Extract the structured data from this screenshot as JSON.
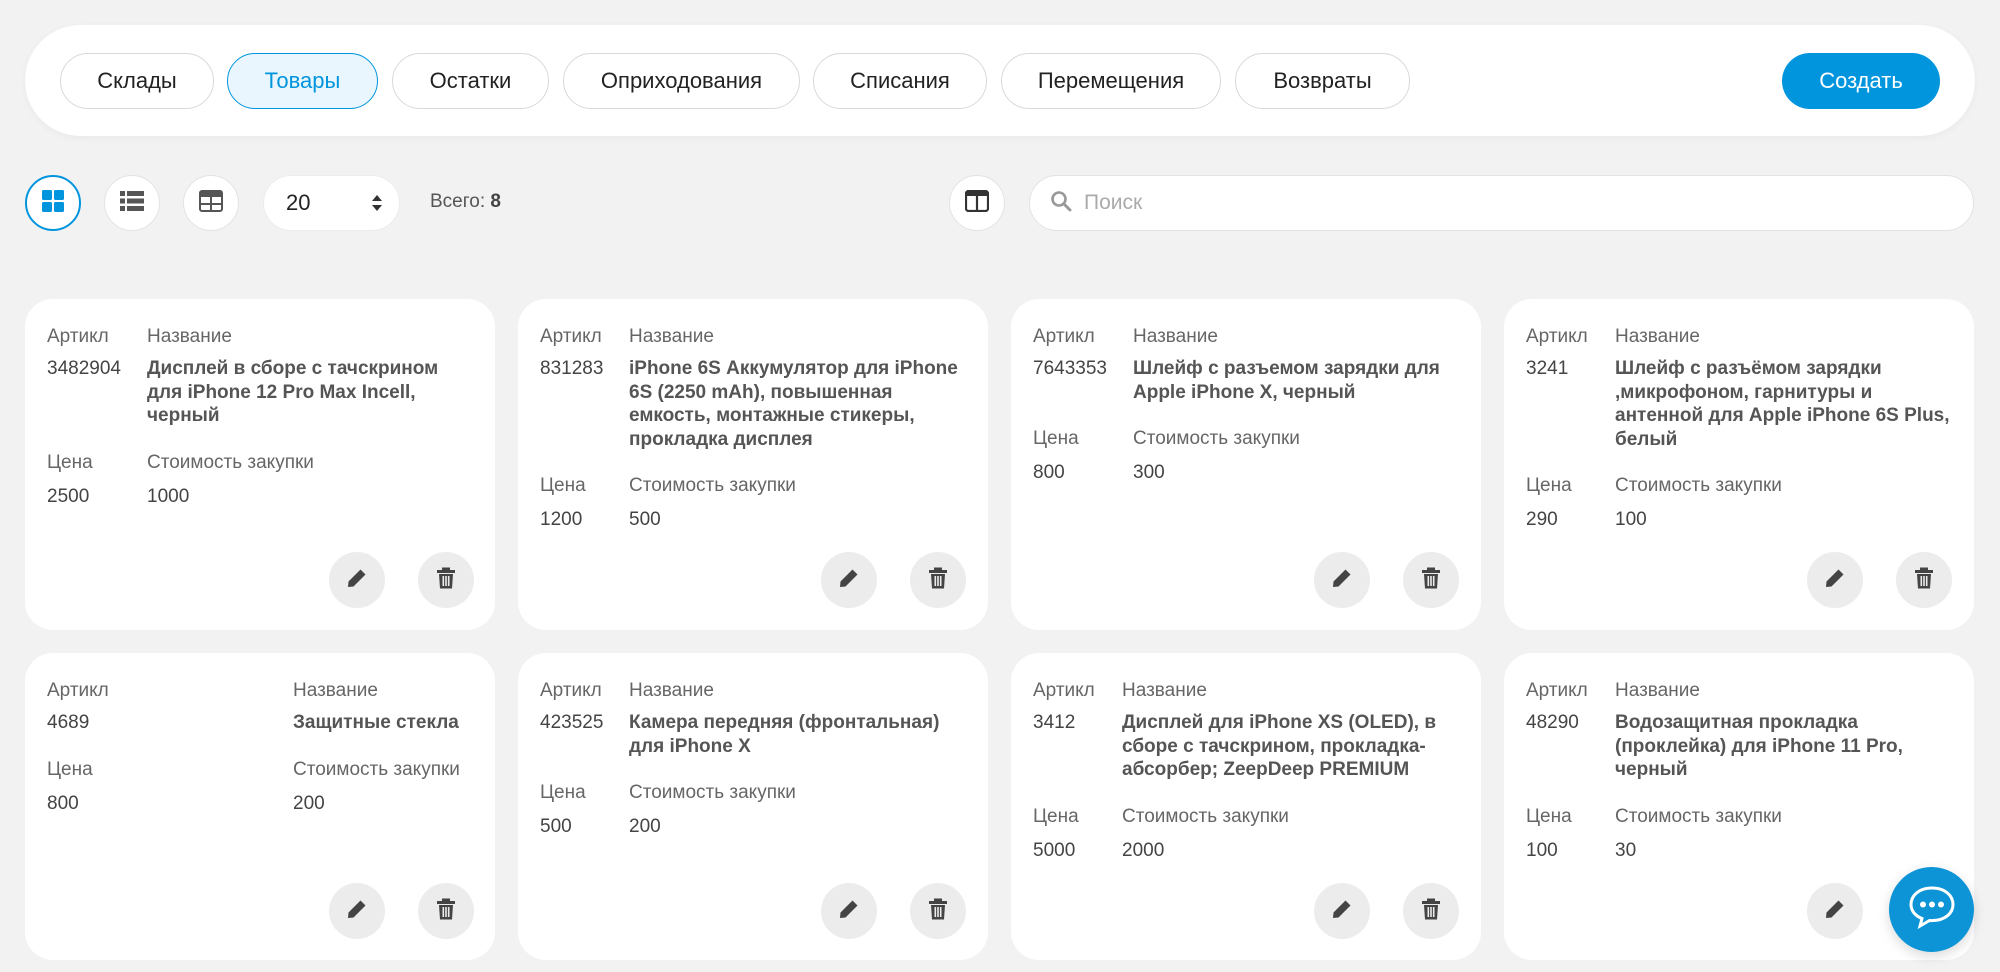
{
  "nav": {
    "tabs": [
      {
        "label": "Склады"
      },
      {
        "label": "Товары"
      },
      {
        "label": "Остатки"
      },
      {
        "label": "Оприходования"
      },
      {
        "label": "Списания"
      },
      {
        "label": "Перемещения"
      },
      {
        "label": "Возвраты"
      }
    ],
    "active_tab": "Товары",
    "create_label": "Создать"
  },
  "toolbar": {
    "per_page": "20",
    "total_label": "Всего:",
    "total_count": "8",
    "search_placeholder": "Поиск"
  },
  "labels": {
    "sku": "Артикл",
    "name": "Название",
    "price": "Цена",
    "cost": "Стоимость закупки"
  },
  "products": [
    {
      "sku": "3482904",
      "name": "Дисплей в сборе с тачскрином для iPhone 12 Pro Max Incell, черный",
      "price": "2500",
      "cost": "1000"
    },
    {
      "sku": "831283",
      "name": "iPhone 6S Аккумулятор для iPhone 6S (2250 mAh), повышенная емкость, монтажные стикеры, прокладка дисплея",
      "price": "1200",
      "cost": "500"
    },
    {
      "sku": "7643353",
      "name": "Шлейф с разъемом зарядки для Apple iPhone X, черный",
      "price": "800",
      "cost": "300"
    },
    {
      "sku": "3241",
      "name": "Шлейф с разъёмом зарядки ,микрофоном, гарнитуры и антенной для Apple iPhone 6S Plus, белый",
      "price": "290",
      "cost": "100"
    },
    {
      "sku": "4689",
      "name": "Защитные стекла",
      "price": "800",
      "cost": "200"
    },
    {
      "sku": "423525",
      "name": "Камера передняя (фронтальная) для iPhone X",
      "price": "500",
      "cost": "200"
    },
    {
      "sku": "3412",
      "name": "Дисплей для iPhone XS (OLED), в сборе с тачскрином, прокладка-абсорбер; ZeepDeep PREMIUM",
      "price": "5000",
      "cost": "2000"
    },
    {
      "sku": "48290",
      "name": "Водозащитная прокладка (проклейка) для iPhone 11 Pro, черный",
      "price": "100",
      "cost": "30"
    }
  ],
  "colors": {
    "accent": "#0095dd",
    "background": "#f2f2f2",
    "card": "#ffffff",
    "action_button": "#ececec"
  },
  "icons": [
    "grid-view-icon",
    "list-view-icon",
    "table-view-icon",
    "columns-icon",
    "search-icon",
    "edit-icon",
    "trash-icon",
    "chat-icon"
  ]
}
